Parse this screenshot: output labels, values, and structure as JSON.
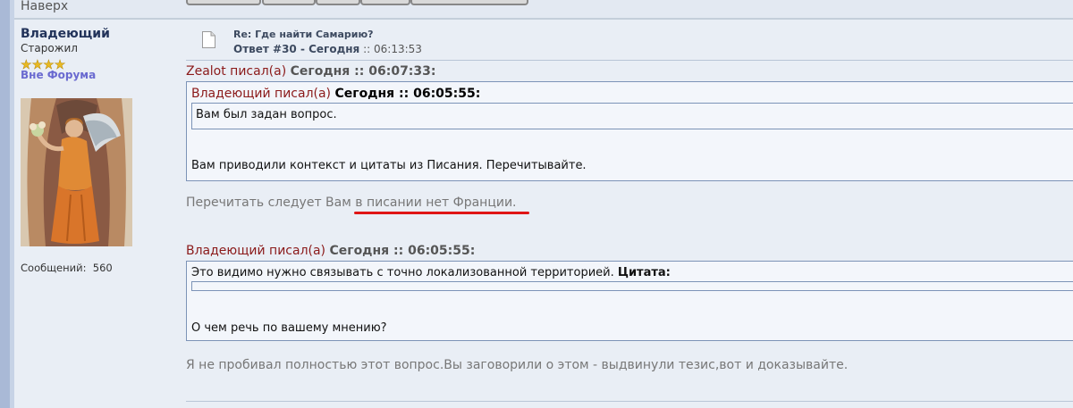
{
  "nav": {
    "top_link": "Наверх"
  },
  "author": {
    "name": "Владеющий",
    "rank": "Старожил",
    "status": "Вне Форума",
    "posts_label": "Сообщений:",
    "posts_count": "560",
    "star_count": 4
  },
  "post": {
    "title": "Re: Где найти Самарию?",
    "reply_label": "Ответ #30 - Сегодня",
    "time_sep": "::",
    "time": "06:13:53"
  },
  "quote1": {
    "author": "Zealot писал(а)",
    "date": "Сегодня :: 06:07:33:",
    "nested": {
      "author": "Владеющий писал(а)",
      "date": "Сегодня :: 06:05:55:",
      "text": "Вам был задан вопрос."
    },
    "text": "Вам приводили контекст и цитаты из Писания. Перечитывайте."
  },
  "reply1": {
    "before": "Перечитать следует Вам ",
    "underlined": "в писании нет Франции."
  },
  "quote2": {
    "author": "Владеющий писал(а)",
    "date": "Сегодня :: 06:05:55:",
    "line1": "Это видимо нужно связывать с точно локализованной территорией.",
    "quote_label": "Цитата:",
    "line2": "О чем речь по вашему мнению?"
  },
  "reply2": {
    "text": "Я не пробивал полностью этот вопрос.Вы заговорили о этом - выдвинули тезис,вот и доказывайте."
  },
  "colors": {
    "quote_author": "#8b1a1a",
    "underline": "#e01515",
    "border": "#7c93b7"
  }
}
